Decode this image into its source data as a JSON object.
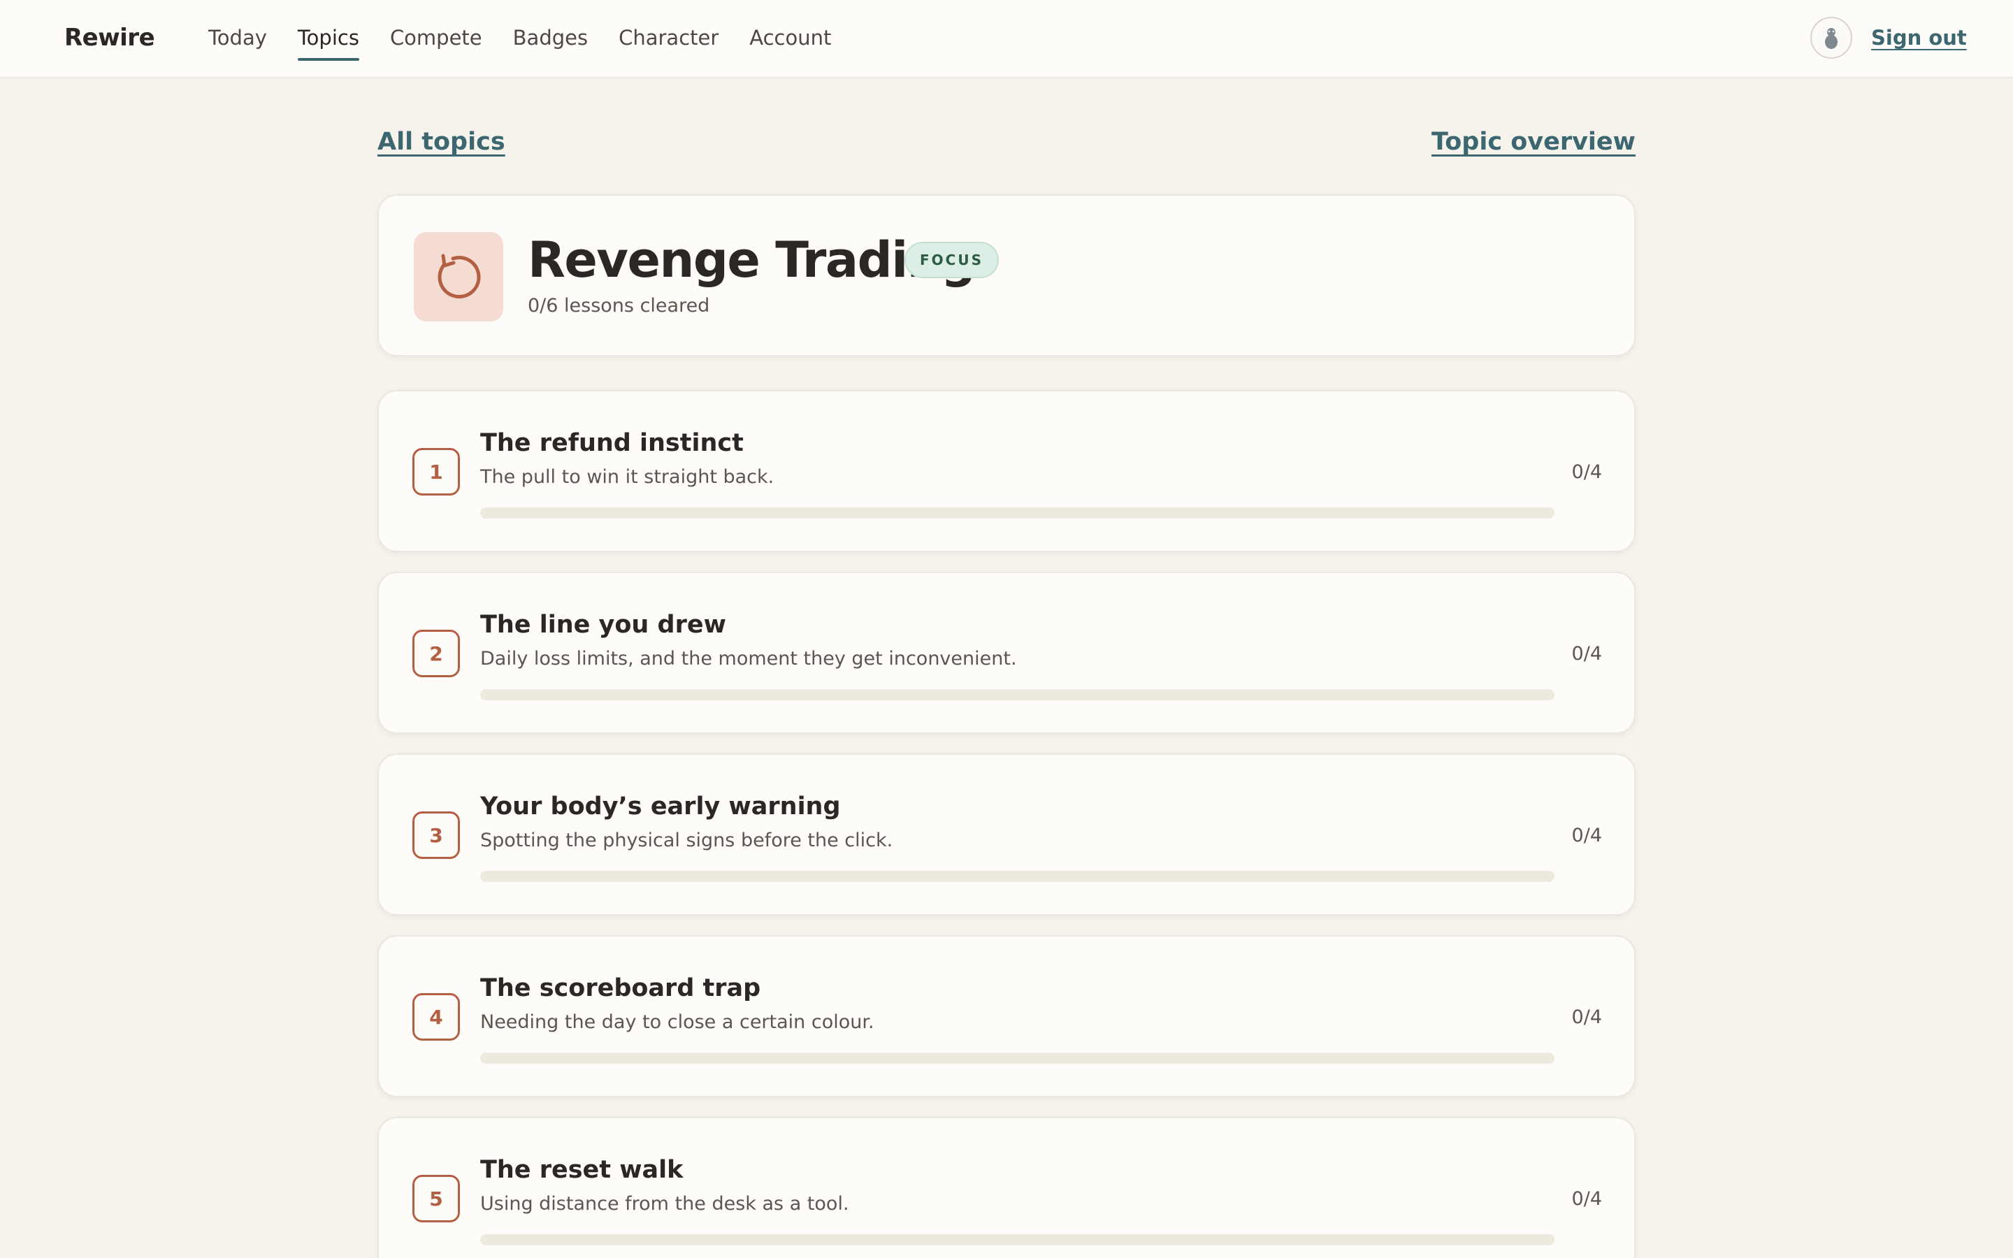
{
  "app": {
    "brand": "Rewire",
    "nav": [
      "Today",
      "Topics",
      "Compete",
      "Badges",
      "Character",
      "Account"
    ],
    "active_nav": "Topics",
    "sign_out": "Sign out"
  },
  "links": {
    "all_topics": "All topics",
    "topic_overview": "Topic overview"
  },
  "topic": {
    "title": "Revenge Trading",
    "badge": "FOCUS",
    "progress_text": "0/6 lessons cleared",
    "icon": "refresh-arrow-icon"
  },
  "lessons": [
    {
      "number": "1",
      "title": "The refund instinct",
      "subtitle": "The pull to win it straight back.",
      "count": "0/4",
      "progress": 0
    },
    {
      "number": "2",
      "title": "The line you drew",
      "subtitle": "Daily loss limits, and the moment they get inconvenient.",
      "count": "0/4",
      "progress": 0
    },
    {
      "number": "3",
      "title": "Your body’s early warning",
      "subtitle": "Spotting the physical signs before the click.",
      "count": "0/4",
      "progress": 0
    },
    {
      "number": "4",
      "title": "The scoreboard trap",
      "subtitle": "Needing the day to close a certain colour.",
      "count": "0/4",
      "progress": 0
    },
    {
      "number": "5",
      "title": "The reset walk",
      "subtitle": "Using distance from the desk as a tool.",
      "count": "0/4",
      "progress": 0
    }
  ],
  "colors": {
    "accent": "#3c6770",
    "lesson_accent": "#b35f43",
    "background": "#f6f2ec",
    "card": "#fdfcf9",
    "focus_badge": "#dceee5"
  }
}
